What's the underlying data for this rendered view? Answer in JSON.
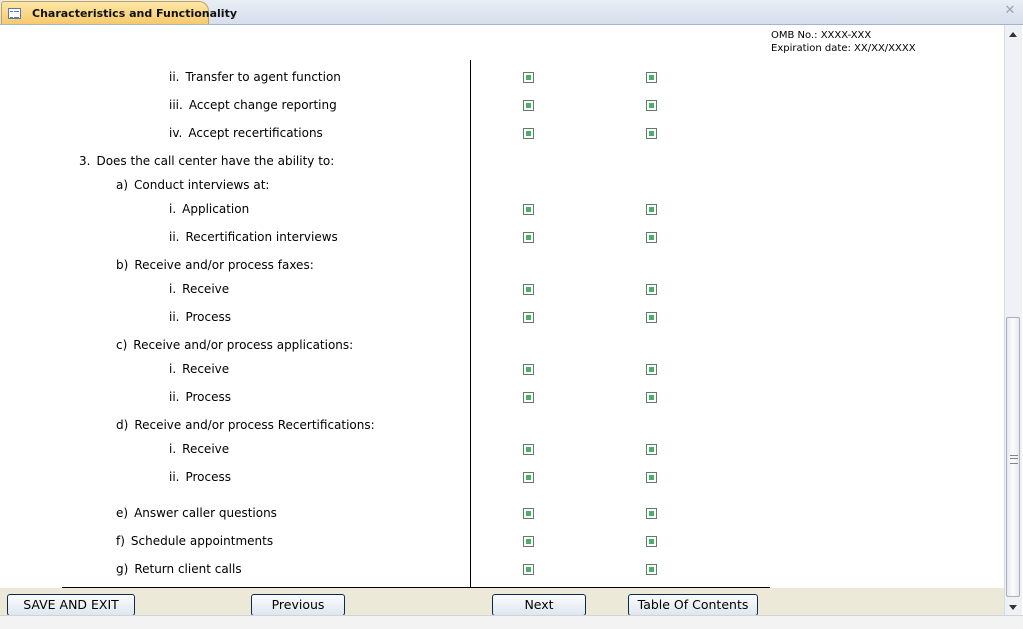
{
  "tab": {
    "title": "Characteristics and Functionality",
    "icon": "form-icon"
  },
  "omb": {
    "number_line": "OMB No.:  XXXX-XXX",
    "expiration_line": "Expiration date:  XX/XX/XXXX"
  },
  "questions": {
    "q2_items": [
      {
        "num": "ii.",
        "label": "Transfer to agent function"
      },
      {
        "num": "iii.",
        "label": "Accept change reporting"
      },
      {
        "num": "iv.",
        "label": "Accept recertifications"
      }
    ],
    "q3": {
      "num": "3.",
      "label": "Does the call center have the ability to:"
    },
    "a": {
      "num": "a)",
      "label": "Conduct interviews at:",
      "items": [
        {
          "num": "i.",
          "label": "Application"
        },
        {
          "num": "ii.",
          "label": "Recertification interviews"
        }
      ]
    },
    "b": {
      "num": "b)",
      "label": "Receive and/or process faxes:",
      "items": [
        {
          "num": "i.",
          "label": "Receive"
        },
        {
          "num": "ii.",
          "label": "Process"
        }
      ]
    },
    "c": {
      "num": "c)",
      "label": "Receive and/or process applications:",
      "items": [
        {
          "num": "i.",
          "label": "Receive"
        },
        {
          "num": "ii.",
          "label": "Process"
        }
      ]
    },
    "d": {
      "num": "d)",
      "label": "Receive and/or process Recertifications:",
      "items": [
        {
          "num": "i.",
          "label": "Receive"
        },
        {
          "num": "ii.",
          "label": "Process"
        }
      ]
    },
    "e": {
      "num": "e)",
      "label": "Answer caller questions"
    },
    "f": {
      "num": "f)",
      "label": "Schedule appointments"
    },
    "g": {
      "num": "g)",
      "label": "Return client calls"
    }
  },
  "buttons": {
    "save_exit": "SAVE AND EXIT",
    "previous": "Previous",
    "next": "Next",
    "toc": "Table Of Contents"
  },
  "colors": {
    "tab_accent": "#f8c96b",
    "checkbox_fill": "#4dae6a"
  }
}
